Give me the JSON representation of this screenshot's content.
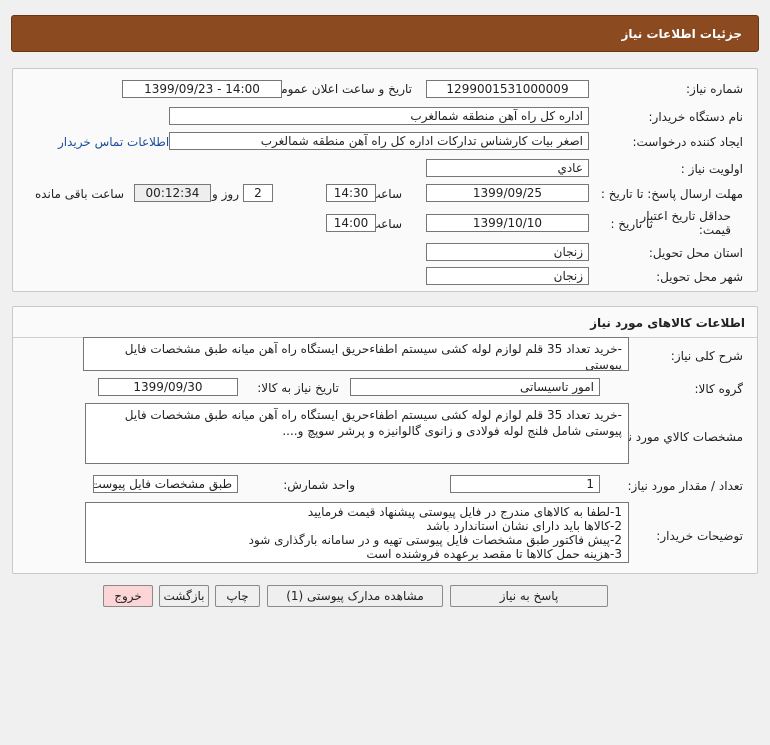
{
  "page": {
    "title": "جزئیات اطلاعات نیاز"
  },
  "need": {
    "need_number_label": "شماره نیاز:",
    "need_number": "1299001531000009",
    "announce_label": "تاریخ و ساعت اعلان عمومی:",
    "announce_value": "1399/09/23 - 14:00",
    "buyer_label": "نام دستگاه خریدار:",
    "buyer": "اداره کل راه آهن منطقه شمالغرب",
    "creator_label": "ایجاد کننده درخواست:",
    "creator": "اصغر بیات کارشناس تدارکات اداره کل راه آهن منطقه شمالغرب",
    "contact_link": "اطلاعات تماس خریدار",
    "priority_label": "اولویت نیاز :",
    "priority": "عادي",
    "deadline_label": "مهلت ارسال پاسخ: تا تاریخ :",
    "deadline_date": "1399/09/25",
    "time_label": "ساعت",
    "deadline_time": "14:30",
    "days": "2",
    "days_suffix": "روز و",
    "remaining": "00:12:34",
    "remaining_suffix": "ساعت باقی مانده",
    "validity_label_1": "حداقل تاریخ اعتبار",
    "validity_label_2": "قیمت:",
    "validity_to": "تا تاریخ :",
    "validity_date": "1399/10/10",
    "validity_time": "14:00",
    "province_label": "استان محل تحویل:",
    "province": "زنجان",
    "city_label": "شهر محل تحویل:",
    "city": "زنجان"
  },
  "goods": {
    "heading": "اطلاعات کالاهای مورد نیاز",
    "summary_label": "شرح کلی نیاز:",
    "summary": "-خرید تعداد 35 قلم لوازم لوله کشی سیستم اطفاءحریق ایستگاه راه آهن میانه طبق مشخصات فایل پیوستی",
    "group_label": "گروه کالا:",
    "group": "امور تاسیساتی",
    "need_date_label": "تاریخ نیاز به کالا:",
    "need_date": "1399/09/30",
    "specs_label": "مشخصات کالاي مورد نیاز:",
    "specs": "-خرید تعداد 35 قلم لوازم لوله کشی سیستم اطفاءحریق ایستگاه راه آهن میانه طبق مشخصات فایل پیوستی شامل فلنج لوله فولادی و زانوی گالوانیزه و پرشر سوپچ و....",
    "qty_label": "تعداد / مقدار مورد نیاز:",
    "qty": "1",
    "unit_label": "واحد شمارش:",
    "unit": "طبق مشخصات فایل پیوست",
    "notes_label": "توضیحات خریدار:",
    "notes": [
      "1-لطفا به کالاهای مندرج در فایل پیوستی پیشنهاد قیمت فرمایید",
      "2-کالاها باید دارای نشان استاندارد باشد",
      "2-پیش فاکتور طبق مشخصات فایل پیوستی تهیه و در سامانه بارگذاری شود",
      "3-هزینه حمل کالاها تا مقصد برعهده فروشنده است"
    ]
  },
  "buttons": {
    "reply": "پاسخ به نیاز",
    "docs": "مشاهده مدارک پیوستی (1)",
    "print": "چاپ",
    "back": "بازگشت",
    "exit": "خروج"
  },
  "colors": {
    "title_bar": "#8b4a20",
    "exit_button": "#fcd6d6"
  }
}
